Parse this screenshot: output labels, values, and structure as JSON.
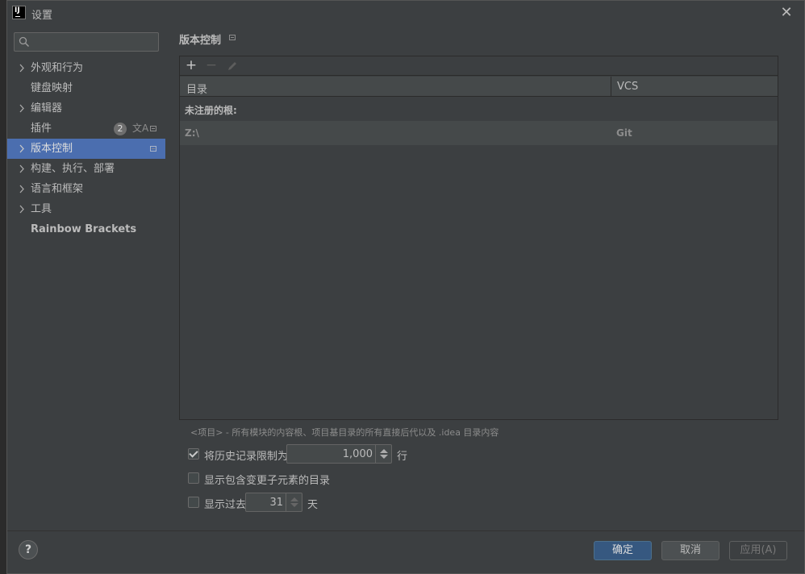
{
  "window": {
    "title": "设置",
    "close_label": "✕"
  },
  "sidebar": {
    "search": {
      "value": "",
      "placeholder": ""
    },
    "items": [
      {
        "label": "外观和行为",
        "expandable": true
      },
      {
        "label": "键盘映射",
        "expandable": false
      },
      {
        "label": "编辑器",
        "expandable": true
      },
      {
        "label": "插件",
        "expandable": false,
        "badge": "2"
      },
      {
        "label": "版本控制",
        "expandable": true,
        "selected": true
      },
      {
        "label": "构建、执行、部署",
        "expandable": true
      },
      {
        "label": "语言和框架",
        "expandable": true
      },
      {
        "label": "工具",
        "expandable": true
      },
      {
        "label": "Rainbow Brackets",
        "expandable": false
      }
    ]
  },
  "main": {
    "title": "版本控制",
    "toolbar": {
      "add": "+",
      "remove": "−"
    },
    "table": {
      "columns": {
        "directory": "目录",
        "vcs": "VCS"
      },
      "group_label": "未注册的根:",
      "rows": [
        {
          "directory": "Z:\\",
          "vcs": "Git"
        }
      ]
    },
    "hint": "<项目> - 所有模块的内容根、项目基目录的所有直接后代以及 .idea 目录内容",
    "history_limit": {
      "checked": true,
      "label": "将历史记录限制为:",
      "value": "1,000",
      "unit": "行"
    },
    "show_changed_dirs": {
      "checked": false,
      "label": "显示包含变更子元素的目录"
    },
    "show_past": {
      "checked": false,
      "label": "显示过去",
      "value": "31",
      "unit": "天"
    }
  },
  "footer": {
    "help": "?",
    "ok": "确定",
    "cancel": "取消",
    "apply": "应用(A)"
  },
  "colors": {
    "background": "#3c3f41",
    "selected": "#4b6eaf",
    "primary_button": "#365880"
  }
}
